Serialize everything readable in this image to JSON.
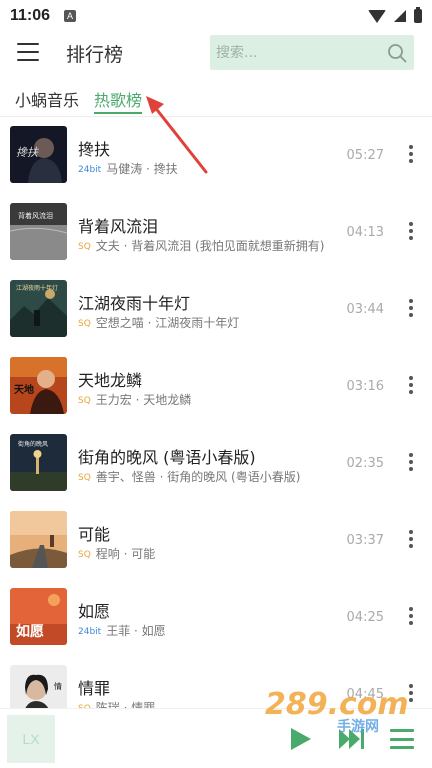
{
  "status_bar": {
    "time": "11:06",
    "notification_letter": "A"
  },
  "header": {
    "title": "排行榜",
    "menu_icon": "hamburger-menu-icon"
  },
  "search": {
    "placeholder": "搜索...",
    "value": "",
    "icon": "search-icon"
  },
  "tabs": [
    {
      "label": "小蜗音乐",
      "active": false
    },
    {
      "label": "热歌榜",
      "active": true
    }
  ],
  "songs": [
    {
      "title": "搀扶",
      "quality": "24bit",
      "subtitle": "马健涛 · 搀扶",
      "duration": "05:27"
    },
    {
      "title": "背着风流泪",
      "quality": "SQ",
      "subtitle": "文夫 · 背着风流泪 (我怕见面就想重新拥有)",
      "duration": "04:13"
    },
    {
      "title": "江湖夜雨十年灯",
      "quality": "SQ",
      "subtitle": "空想之喵 · 江湖夜雨十年灯",
      "duration": "03:44"
    },
    {
      "title": "天地龙鳞",
      "quality": "SQ",
      "subtitle": "王力宏 · 天地龙鳞",
      "duration": "03:16"
    },
    {
      "title": "街角的晚风 (粤语小春版)",
      "quality": "SQ",
      "subtitle": "善宇、怪兽 · 街角的晚风 (粤语小春版)",
      "duration": "02:35"
    },
    {
      "title": "可能",
      "quality": "SQ",
      "subtitle": "程响 · 可能",
      "duration": "03:37"
    },
    {
      "title": "如愿",
      "quality": "24bit",
      "subtitle": "王菲 · 如愿",
      "duration": "04:25"
    },
    {
      "title": "情罪",
      "quality": "SQ",
      "subtitle": "陈瑞 · 情罪",
      "duration": "04:45"
    }
  ],
  "player": {
    "cover_text": "LX",
    "play_icon": "play-icon",
    "next_icon": "next-track-icon",
    "playlist_icon": "playlist-icon"
  },
  "watermark": {
    "main": "289.com",
    "sub": "手游网"
  },
  "colors": {
    "accent": "#4aaa6b",
    "search_bg": "#dcefe3",
    "sq": "#e8a53a",
    "bit24": "#3a8ad8",
    "annotation_arrow": "#e0413a"
  }
}
